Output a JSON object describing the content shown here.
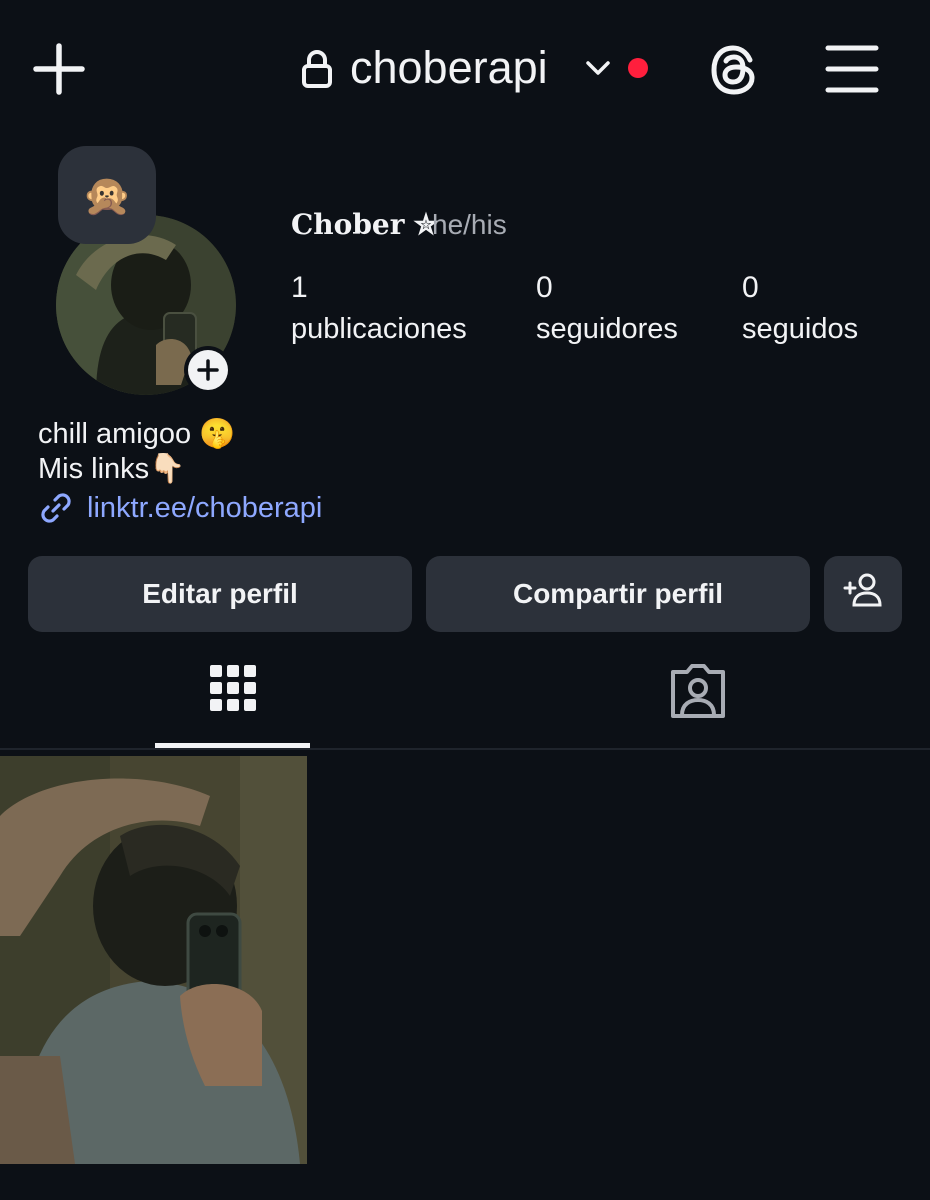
{
  "header": {
    "username": "choberapi",
    "icons": [
      "plus-icon",
      "lock-icon",
      "chevron-down-icon",
      "notification-dot",
      "threads-icon",
      "hamburger-menu-icon"
    ],
    "notification_color": "#ff1f3d"
  },
  "profile": {
    "note_emoji": "🙊",
    "display_name": "Chober ✮",
    "pronouns": "he/his",
    "stats": [
      {
        "value": "1",
        "label": "publicaciones"
      },
      {
        "value": "0",
        "label": "seguidores"
      },
      {
        "value": "0",
        "label": "seguidos"
      }
    ],
    "bio": [
      "chill amigoo 🤫",
      "Mis links👇🏻"
    ],
    "link": "linktr.ee/choberapi",
    "link_color": "#8ea8ff"
  },
  "actions": {
    "edit_label": "Editar perfil",
    "share_label": "Compartir perfil",
    "add_user_icon": "add-user-icon"
  },
  "tabs": [
    {
      "name": "posts-grid",
      "icon": "grid-icon",
      "active": true
    },
    {
      "name": "tagged",
      "icon": "tagged-person-icon",
      "active": false
    }
  ],
  "posts_count_shown": 1
}
